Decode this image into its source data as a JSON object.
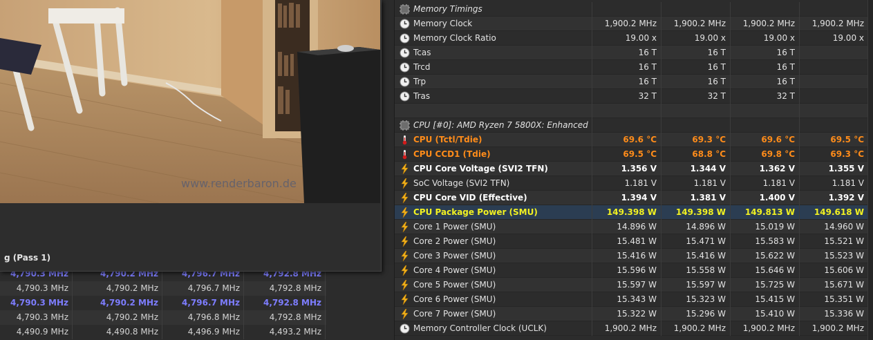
{
  "render_window": {
    "watermark": "www.renderbaron.de",
    "status_text": "g (Pass 1)"
  },
  "left_table": {
    "rows": [
      {
        "values": [
          "4,790.3 MHz",
          "4,790.2 MHz",
          "4,796.7 MHz",
          "4,792.8 MHz"
        ],
        "style": "bold"
      },
      {
        "values": [
          "4,790.3 MHz",
          "4,790.2 MHz",
          "4,796.7 MHz",
          "4,792.8 MHz"
        ],
        "style": "normal"
      },
      {
        "values": [
          "4,790.3 MHz",
          "4,790.2 MHz",
          "4,796.7 MHz",
          "4,792.8 MHz"
        ],
        "style": "bold"
      },
      {
        "values": [
          "4,790.3 MHz",
          "4,790.2 MHz",
          "4,796.8 MHz",
          "4,792.8 MHz"
        ],
        "style": "normal"
      },
      {
        "values": [
          "4,490.9 MHz",
          "4,490.8 MHz",
          "4,496.9 MHz",
          "4,493.2 MHz"
        ],
        "style": "normal"
      }
    ]
  },
  "sensor_panel": {
    "rows": [
      {
        "icon": "chip-icon",
        "label": "Memory Timings",
        "values": [
          "",
          "",
          "",
          ""
        ],
        "style": "group"
      },
      {
        "icon": "clock-icon",
        "label": "Memory Clock",
        "values": [
          "1,900.2 MHz",
          "1,900.2 MHz",
          "1,900.2 MHz",
          "1,900.2 MHz"
        ],
        "style": "normal"
      },
      {
        "icon": "clock-icon",
        "label": "Memory Clock Ratio",
        "values": [
          "19.00 x",
          "19.00 x",
          "19.00 x",
          "19.00 x"
        ],
        "style": "normal"
      },
      {
        "icon": "clock-icon",
        "label": "Tcas",
        "values": [
          "16 T",
          "16 T",
          "16 T",
          ""
        ],
        "style": "normal"
      },
      {
        "icon": "clock-icon",
        "label": "Trcd",
        "values": [
          "16 T",
          "16 T",
          "16 T",
          ""
        ],
        "style": "normal"
      },
      {
        "icon": "clock-icon",
        "label": "Trp",
        "values": [
          "16 T",
          "16 T",
          "16 T",
          ""
        ],
        "style": "normal"
      },
      {
        "icon": "clock-icon",
        "label": "Tras",
        "values": [
          "32 T",
          "32 T",
          "32 T",
          ""
        ],
        "style": "normal"
      },
      {
        "icon": "",
        "label": "",
        "values": [
          "",
          "",
          "",
          ""
        ],
        "style": "normal"
      },
      {
        "icon": "chip-icon",
        "label": "CPU [#0]: AMD Ryzen 7 5800X: Enhanced",
        "values": [
          "",
          "",
          "",
          ""
        ],
        "style": "group"
      },
      {
        "icon": "thermometer-icon",
        "label": "CPU (Tctl/Tdie)",
        "values": [
          "69.6 °C",
          "69.3 °C",
          "69.6 °C",
          "69.5 °C"
        ],
        "style": "orange"
      },
      {
        "icon": "thermometer-icon",
        "label": "CPU CCD1 (Tdie)",
        "values": [
          "69.5 °C",
          "68.8 °C",
          "69.8 °C",
          "69.3 °C"
        ],
        "style": "orange"
      },
      {
        "icon": "lightning-icon",
        "label": "CPU Core Voltage (SVI2 TFN)",
        "values": [
          "1.356 V",
          "1.344 V",
          "1.362 V",
          "1.355 V"
        ],
        "style": "bold"
      },
      {
        "icon": "lightning-icon",
        "label": "SoC Voltage (SVI2 TFN)",
        "values": [
          "1.181 V",
          "1.181 V",
          "1.181 V",
          "1.181 V"
        ],
        "style": "normal"
      },
      {
        "icon": "lightning-icon",
        "label": "CPU Core VID (Effective)",
        "values": [
          "1.394 V",
          "1.381 V",
          "1.400 V",
          "1.392 V"
        ],
        "style": "bold"
      },
      {
        "icon": "lightning-icon",
        "label": "CPU Package Power (SMU)",
        "values": [
          "149.398 W",
          "149.398 W",
          "149.813 W",
          "149.618 W"
        ],
        "style": "yellow"
      },
      {
        "icon": "lightning-icon",
        "label": "Core 1 Power (SMU)",
        "values": [
          "14.896 W",
          "14.896 W",
          "15.019 W",
          "14.960 W"
        ],
        "style": "normal"
      },
      {
        "icon": "lightning-icon",
        "label": "Core 2 Power (SMU)",
        "values": [
          "15.481 W",
          "15.471 W",
          "15.583 W",
          "15.521 W"
        ],
        "style": "normal"
      },
      {
        "icon": "lightning-icon",
        "label": "Core 3 Power (SMU)",
        "values": [
          "15.416 W",
          "15.416 W",
          "15.622 W",
          "15.523 W"
        ],
        "style": "normal"
      },
      {
        "icon": "lightning-icon",
        "label": "Core 4 Power (SMU)",
        "values": [
          "15.596 W",
          "15.558 W",
          "15.646 W",
          "15.606 W"
        ],
        "style": "normal"
      },
      {
        "icon": "lightning-icon",
        "label": "Core 5 Power (SMU)",
        "values": [
          "15.597 W",
          "15.597 W",
          "15.725 W",
          "15.671 W"
        ],
        "style": "normal"
      },
      {
        "icon": "lightning-icon",
        "label": "Core 6 Power (SMU)",
        "values": [
          "15.343 W",
          "15.323 W",
          "15.415 W",
          "15.351 W"
        ],
        "style": "normal"
      },
      {
        "icon": "lightning-icon",
        "label": "Core 7 Power (SMU)",
        "values": [
          "15.322 W",
          "15.296 W",
          "15.410 W",
          "15.336 W"
        ],
        "style": "normal"
      },
      {
        "icon": "clock-icon",
        "label": "Memory Controller Clock (UCLK)",
        "values": [
          "1,900.2 MHz",
          "1,900.2 MHz",
          "1,900.2 MHz",
          "1,900.2 MHz"
        ],
        "style": "normal"
      }
    ]
  }
}
